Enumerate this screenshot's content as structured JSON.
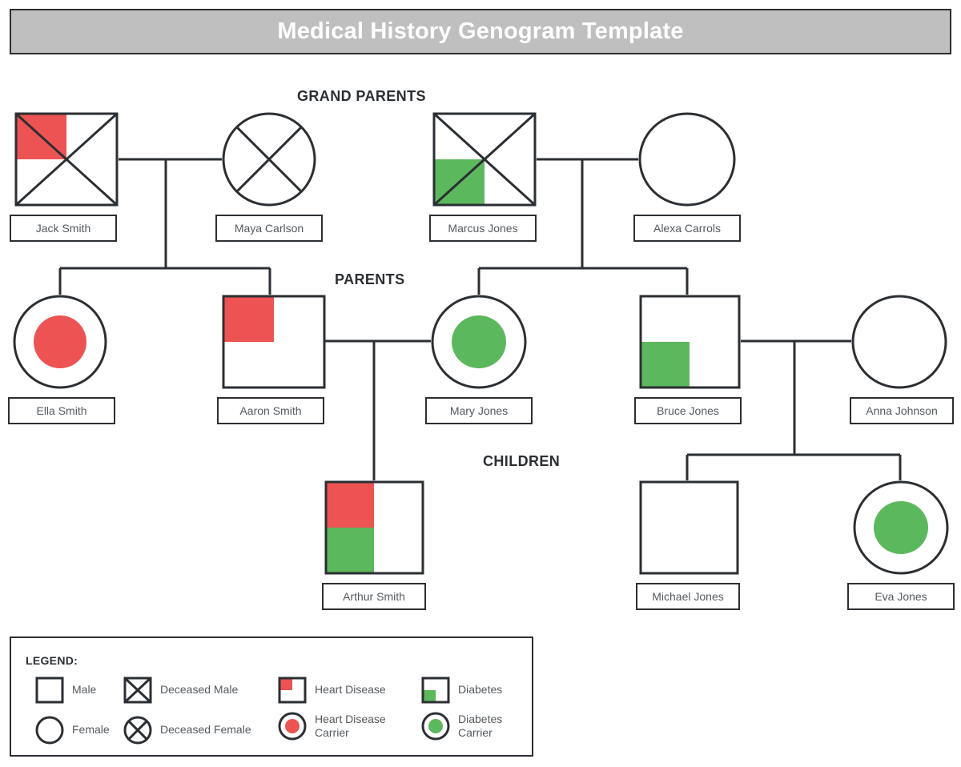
{
  "title": "Medical History Genogram Template",
  "colors": {
    "heart_disease": "#ee5353",
    "diabetes": "#5cb85c",
    "stroke": "#2b2f33",
    "banner_bg": "#bfbfbf",
    "banner_text": "#ffffff",
    "label_text": "#555a5e"
  },
  "sections": [
    {
      "id": "grandparents",
      "label": "GRAND PARENTS"
    },
    {
      "id": "parents",
      "label": "PARENTS"
    },
    {
      "id": "children",
      "label": "CHILDREN"
    }
  ],
  "people": [
    {
      "id": "jack-smith",
      "name": "Jack Smith",
      "generation": "grandparents",
      "shape": "square",
      "deceased": true,
      "markers": [
        "heart-disease"
      ]
    },
    {
      "id": "maya-carlson",
      "name": "Maya Carlson",
      "generation": "grandparents",
      "shape": "circle",
      "deceased": true,
      "markers": []
    },
    {
      "id": "marcus-jones",
      "name": "Marcus Jones",
      "generation": "grandparents",
      "shape": "square",
      "deceased": true,
      "markers": [
        "diabetes"
      ]
    },
    {
      "id": "alexa-carrols",
      "name": "Alexa Carrols",
      "generation": "grandparents",
      "shape": "circle",
      "deceased": false,
      "markers": []
    },
    {
      "id": "ella-smith",
      "name": "Ella Smith",
      "generation": "parents",
      "shape": "circle",
      "deceased": false,
      "markers": [
        "heart-disease-carrier"
      ]
    },
    {
      "id": "aaron-smith",
      "name": "Aaron Smith",
      "generation": "parents",
      "shape": "square",
      "deceased": false,
      "markers": [
        "heart-disease"
      ]
    },
    {
      "id": "mary-jones",
      "name": "Mary Jones",
      "generation": "parents",
      "shape": "circle",
      "deceased": false,
      "markers": [
        "diabetes-carrier"
      ]
    },
    {
      "id": "bruce-jones",
      "name": "Bruce Jones",
      "generation": "parents",
      "shape": "square",
      "deceased": false,
      "markers": [
        "diabetes"
      ]
    },
    {
      "id": "anna-johnson",
      "name": "Anna Johnson",
      "generation": "parents",
      "shape": "circle",
      "deceased": false,
      "markers": []
    },
    {
      "id": "arthur-smith",
      "name": "Arthur Smith",
      "generation": "children",
      "shape": "square",
      "deceased": false,
      "markers": [
        "heart-disease",
        "diabetes"
      ]
    },
    {
      "id": "michael-jones",
      "name": "Michael Jones",
      "generation": "children",
      "shape": "square",
      "deceased": false,
      "markers": []
    },
    {
      "id": "eva-jones",
      "name": "Eva Jones",
      "generation": "children",
      "shape": "circle",
      "deceased": false,
      "markers": [
        "diabetes-carrier"
      ]
    }
  ],
  "legend": {
    "title": "LEGEND:",
    "items": [
      {
        "id": "male",
        "label": "Male",
        "glyph": "square"
      },
      {
        "id": "deceased-male",
        "label": "Deceased Male",
        "glyph": "square-x"
      },
      {
        "id": "heart-disease",
        "label": "Heart Disease",
        "glyph": "square-tl-red"
      },
      {
        "id": "diabetes",
        "label": "Diabetes",
        "glyph": "square-bl-green"
      },
      {
        "id": "female",
        "label": "Female",
        "glyph": "circle"
      },
      {
        "id": "deceased-female",
        "label": "Deceased Female",
        "glyph": "circle-x"
      },
      {
        "id": "heart-disease-carrier",
        "label": "Heart Disease\nCarrier",
        "glyph": "circle-red-dot"
      },
      {
        "id": "diabetes-carrier",
        "label": "Diabetes\nCarrier",
        "glyph": "circle-green-dot"
      }
    ]
  }
}
